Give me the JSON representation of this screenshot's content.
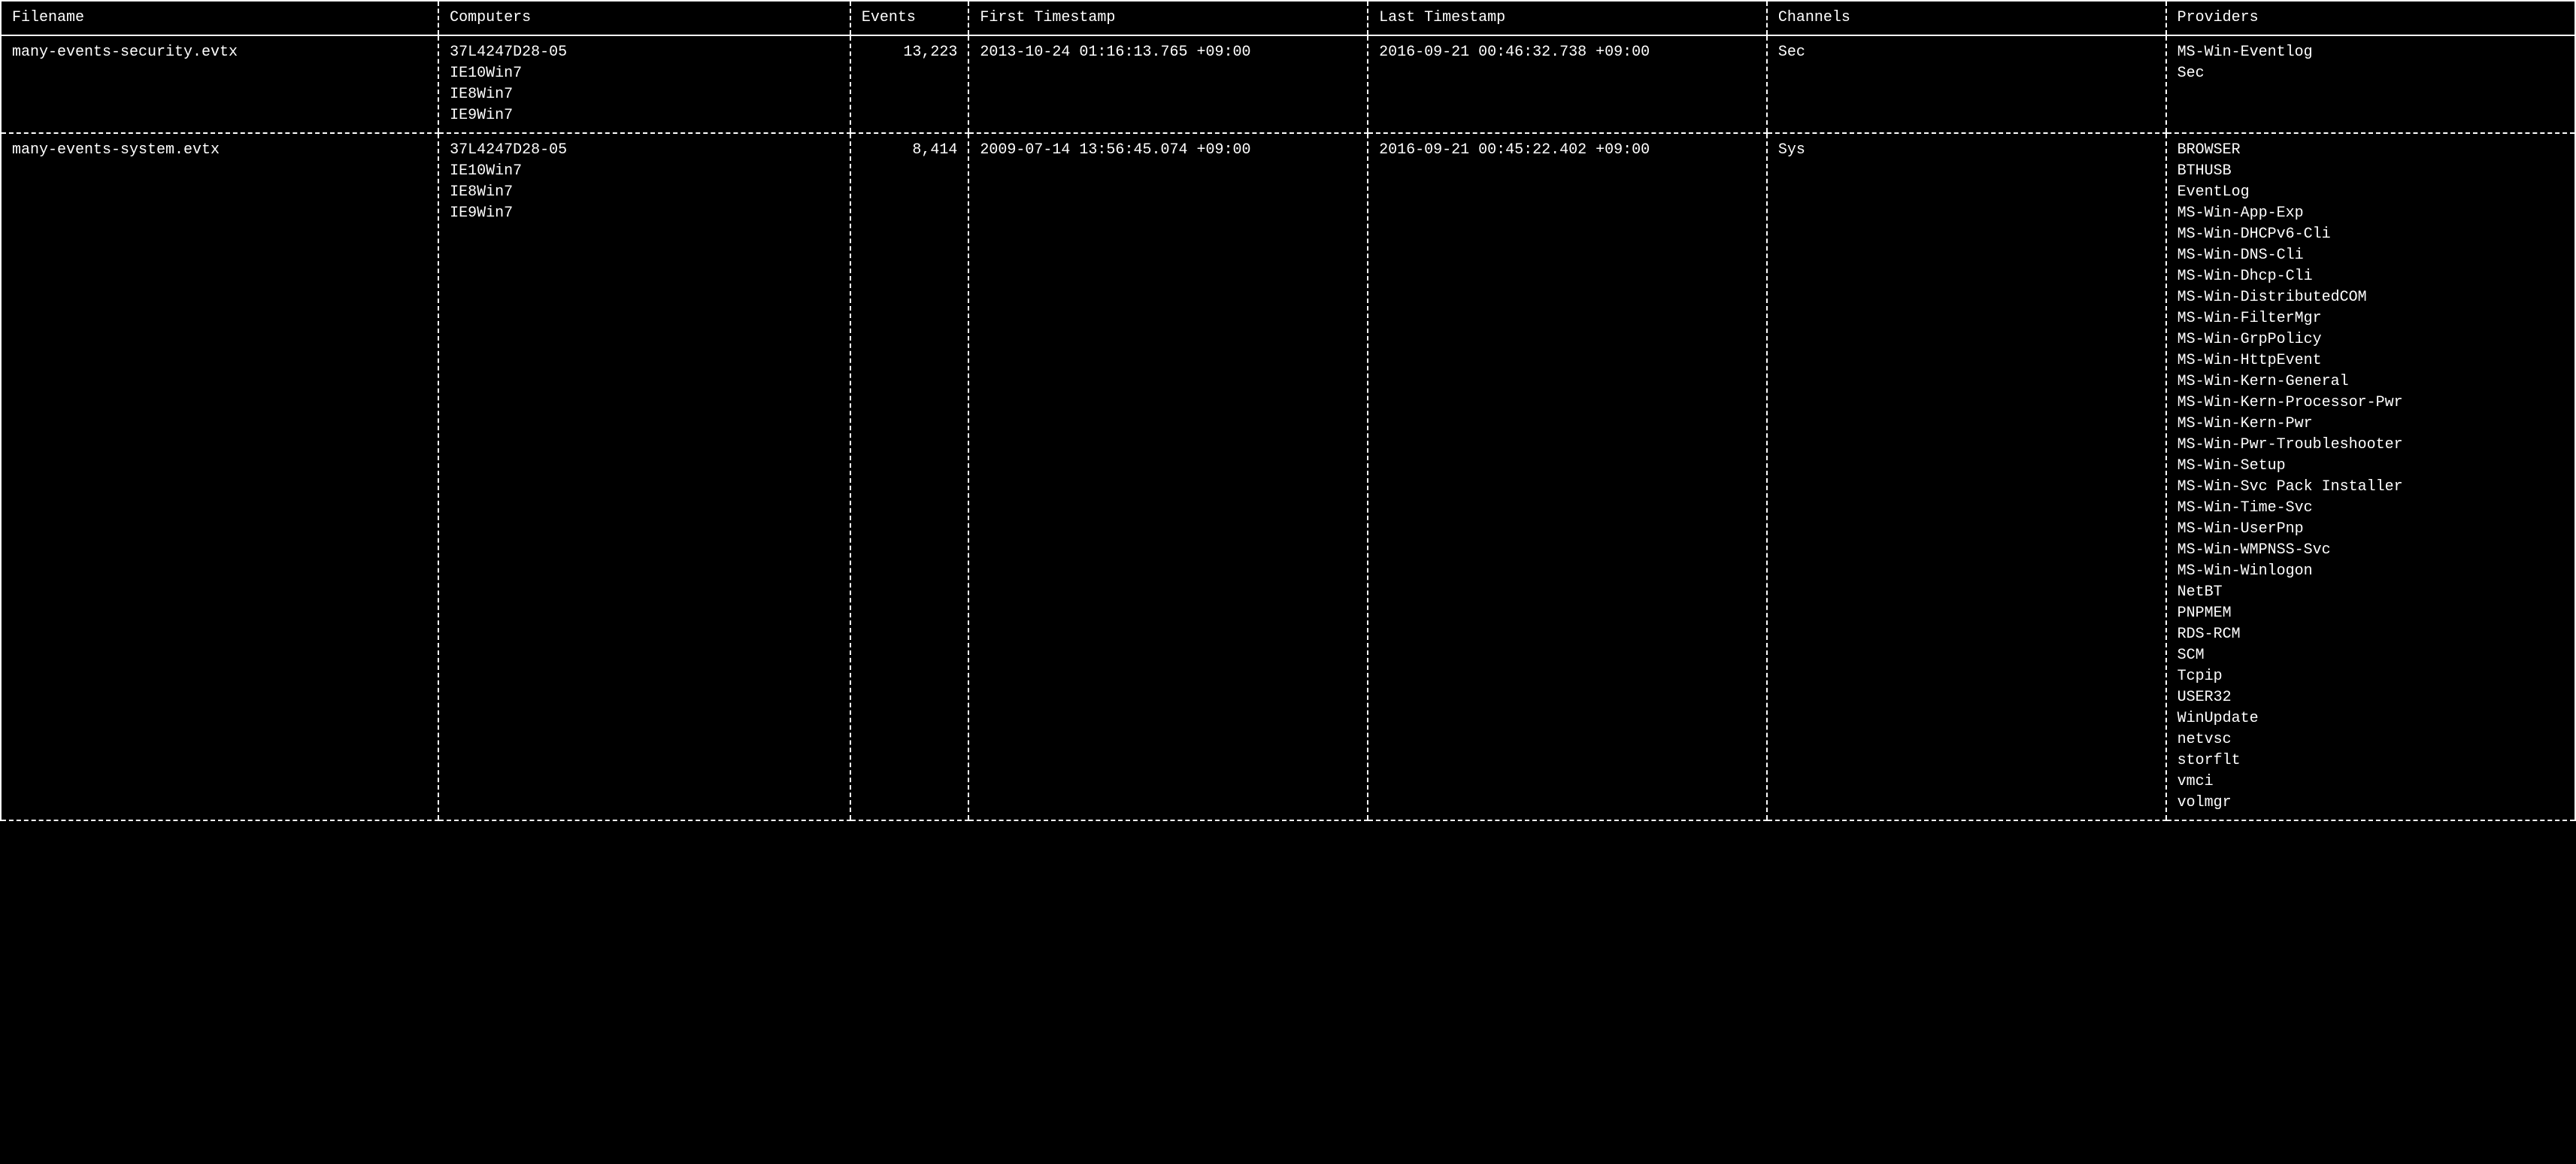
{
  "table": {
    "headers": {
      "filename": "Filename",
      "computers": "Computers",
      "events": "Events",
      "first_timestamp": "First Timestamp",
      "last_timestamp": "Last Timestamp",
      "channels": "Channels",
      "providers": "Providers"
    },
    "rows": [
      {
        "filename": "many-events-security.evtx",
        "computers": "37L4247D28-05\nIE10Win7\nIE8Win7\nIE9Win7",
        "events": "13,223",
        "first_timestamp": "2013-10-24 01:16:13.765 +09:00",
        "last_timestamp": "2016-09-21 00:46:32.738 +09:00",
        "channels": "Sec",
        "providers": "MS-Win-Eventlog\nSec"
      },
      {
        "filename": "many-events-system.evtx",
        "computers": "37L4247D28-05\nIE10Win7\nIE8Win7\nIE9Win7",
        "events": "8,414",
        "first_timestamp": "2009-07-14 13:56:45.074 +09:00",
        "last_timestamp": "2016-09-21 00:45:22.402 +09:00",
        "channels": "Sys",
        "providers": "BROWSER\nBTHUSB\nEventLog\nMS-Win-App-Exp\nMS-Win-DHCPv6-Cli\nMS-Win-DNS-Cli\nMS-Win-Dhcp-Cli\nMS-Win-DistributedCOM\nMS-Win-FilterMgr\nMS-Win-GrpPolicy\nMS-Win-HttpEvent\nMS-Win-Kern-General\nMS-Win-Kern-Processor-Pwr\nMS-Win-Kern-Pwr\nMS-Win-Pwr-Troubleshooter\nMS-Win-Setup\nMS-Win-Svc Pack Installer\nMS-Win-Time-Svc\nMS-Win-UserPnp\nMS-Win-WMPNSS-Svc\nMS-Win-Winlogon\nNetBT\nPNPMEM\nRDS-RCM\nSCM\nTcpip\nUSER32\nWinUpdate\nnetvsc\nstorflt\nvmci\nvolmgr"
      }
    ]
  }
}
